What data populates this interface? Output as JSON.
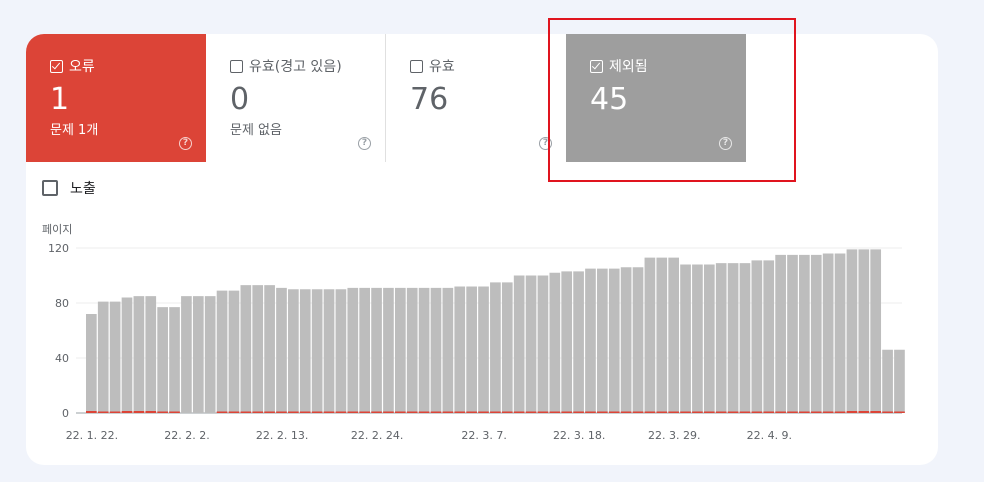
{
  "tiles": {
    "error": {
      "label": "오류",
      "value": "1",
      "sub": "문제 1개",
      "checked": true
    },
    "warning": {
      "label": "유효(경고 있음)",
      "value": "0",
      "sub": "문제 없음",
      "checked": false
    },
    "valid": {
      "label": "유효",
      "value": "76",
      "sub": "",
      "checked": false
    },
    "excluded": {
      "label": "제외됨",
      "value": "45",
      "sub": "",
      "checked": true
    }
  },
  "help_glyph": "?",
  "impressions": {
    "label": "노출",
    "checked": false
  },
  "colors": {
    "error": "#dc4437",
    "excluded": "#9e9e9e",
    "bar": "#bdbdbd",
    "highlight": "#e0141e"
  },
  "chart_data": {
    "type": "bar",
    "ylabel": "페이지",
    "ylim": [
      0,
      120
    ],
    "yticks": [
      0,
      40,
      80,
      120
    ],
    "xticks": [
      "22. 1. 22.",
      "22. 2. 2.",
      "22. 2. 13.",
      "22. 2. 24.",
      "22. 3. 7.",
      "22. 3. 18.",
      "22. 3. 29.",
      "22. 4. 9."
    ],
    "series": [
      {
        "values": [
          72,
          81,
          81,
          84,
          85,
          85,
          77,
          77,
          85,
          85,
          85,
          89,
          89,
          93,
          93,
          93,
          91,
          90,
          90,
          90,
          90,
          90,
          91,
          91,
          91,
          91,
          91,
          91,
          91,
          91,
          91,
          92,
          92,
          92,
          95,
          95,
          100,
          100,
          100,
          102,
          103,
          103,
          105,
          105,
          105,
          106,
          106,
          113,
          113,
          113,
          108,
          108,
          108,
          109,
          109,
          109,
          111,
          111,
          115,
          115,
          115,
          115,
          116,
          116,
          119,
          119,
          119,
          46,
          46
        ],
        "color": "#bdbdbd"
      },
      {
        "values": [
          2,
          1,
          1,
          2,
          2,
          2,
          1,
          1,
          0,
          0,
          0,
          1,
          1,
          1,
          1,
          1,
          1,
          1,
          1,
          1,
          1,
          1,
          1,
          1,
          1,
          1,
          1,
          1,
          1,
          1,
          1,
          1,
          1,
          1,
          1,
          1,
          1,
          1,
          1,
          1,
          1,
          1,
          1,
          1,
          1,
          1,
          1,
          1,
          1,
          1,
          1,
          1,
          1,
          1,
          1,
          1,
          1,
          1,
          1,
          1,
          1,
          1,
          1,
          1,
          2,
          2,
          2,
          1,
          1
        ],
        "color": "#dc4437"
      }
    ]
  }
}
